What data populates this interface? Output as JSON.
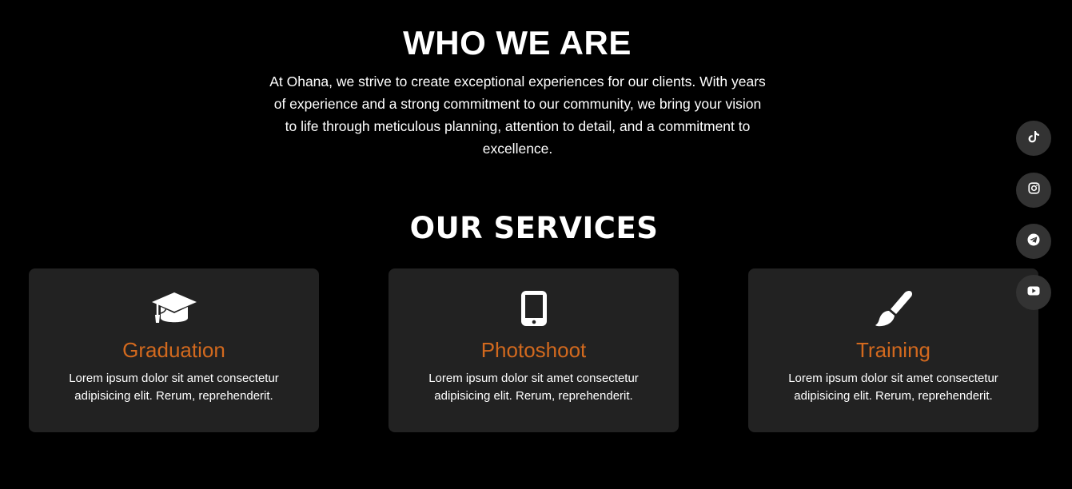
{
  "about": {
    "title": "WHO WE ARE",
    "text": "At Ohana, we strive to create exceptional experiences for our clients. With years of experience and a strong commitment to our community, we bring your vision to life through meticulous planning, attention to detail, and a commitment to excellence."
  },
  "services": {
    "title": "OUR SERVICES",
    "items": [
      {
        "icon": "graduation-cap-icon",
        "title": "Graduation",
        "text": "Lorem ipsum dolor sit amet consectetur adipisicing elit. Rerum, reprehenderit."
      },
      {
        "icon": "mobile-phone-icon",
        "title": "Photoshoot",
        "text": "Lorem ipsum dolor sit amet consectetur adipisicing elit. Rerum, reprehenderit."
      },
      {
        "icon": "paint-brush-icon",
        "title": "Training",
        "text": "Lorem ipsum dolor sit amet consectetur adipisicing elit. Rerum, reprehenderit."
      }
    ]
  },
  "social": {
    "items": [
      {
        "icon": "tiktok-icon"
      },
      {
        "icon": "instagram-icon"
      },
      {
        "icon": "telegram-icon"
      },
      {
        "icon": "youtube-icon"
      }
    ]
  },
  "colors": {
    "background": "#000000",
    "card_background": "#222222",
    "accent": "#d2691e",
    "social_button": "#333333",
    "text": "#ffffff"
  }
}
